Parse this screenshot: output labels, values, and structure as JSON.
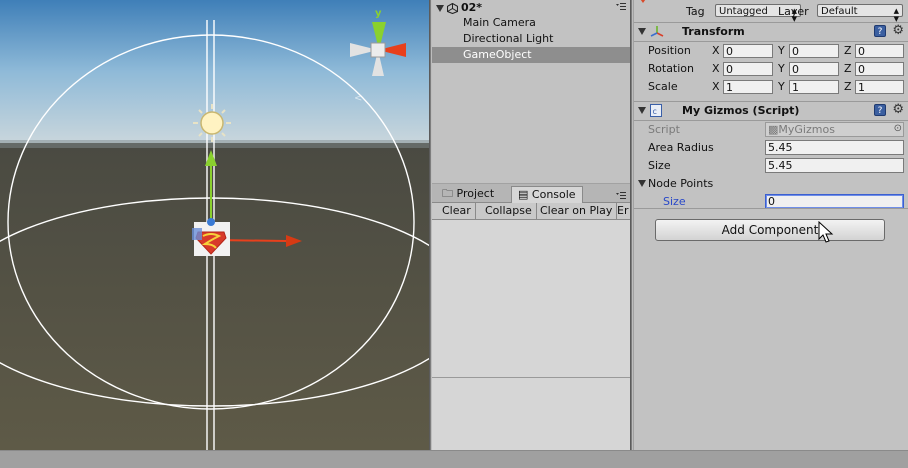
{
  "hierarchy": {
    "scene_name": "02*",
    "items": [
      {
        "label": "Main Camera",
        "selected": false
      },
      {
        "label": "Directional Light",
        "selected": false
      },
      {
        "label": "GameObject",
        "selected": true
      }
    ]
  },
  "console_panel": {
    "tabs": [
      {
        "label": "Project",
        "active": false
      },
      {
        "label": "Console",
        "active": true
      }
    ],
    "toolbar": [
      "Clear",
      "Collapse",
      "Clear on Play",
      "Er"
    ]
  },
  "inspector": {
    "tag_label": "Tag",
    "tag_value": "Untagged",
    "layer_label": "Layer",
    "layer_value": "Default",
    "transform": {
      "title": "Transform",
      "rows": [
        {
          "label": "Position",
          "x": "0",
          "y": "0",
          "z": "0"
        },
        {
          "label": "Rotation",
          "x": "0",
          "y": "0",
          "z": "0"
        },
        {
          "label": "Scale",
          "x": "1",
          "y": "1",
          "z": "1"
        }
      ],
      "axis_labels": [
        "X",
        "Y",
        "Z"
      ]
    },
    "script_component": {
      "title": "My Gizmos (Script)",
      "script_label": "Script",
      "script_value": "MyGizmos",
      "area_radius_label": "Area Radius",
      "area_radius_value": "5.45",
      "size_label": "Size",
      "size_value": "5.45",
      "node_points_label": "Node Points",
      "node_size_label": "Size",
      "node_size_value": "0"
    },
    "add_component_label": "Add Component"
  },
  "scene_gizmo": {
    "axis_y_label": "y",
    "axis_x_color": "#e8401c",
    "axis_y_color": "#8ad12e",
    "axis_z_color": "#3a7bd5"
  },
  "colors": {
    "selection": "#8e8e8e",
    "focus": "#3b5fd0",
    "link_blue": "#2848c8"
  }
}
